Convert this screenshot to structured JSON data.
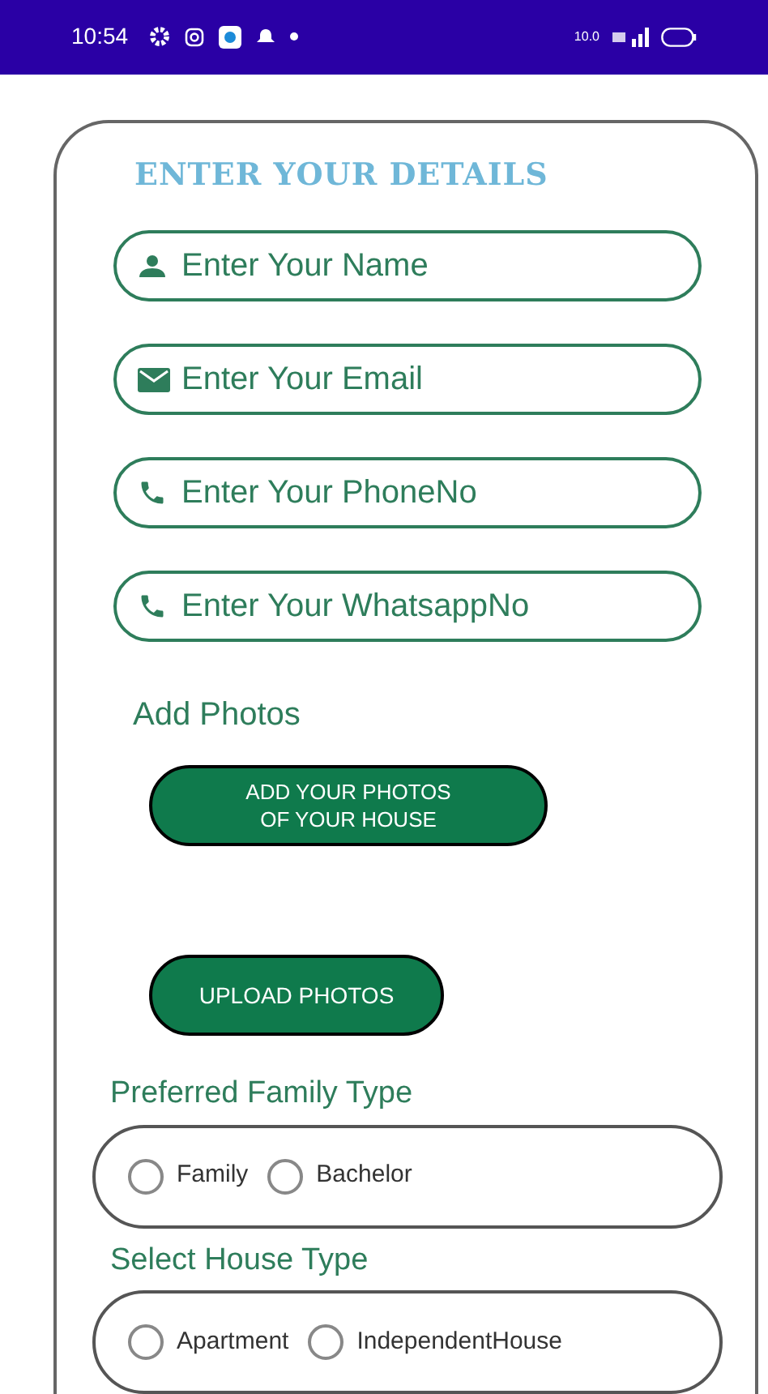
{
  "status_bar": {
    "time": "10:54",
    "speed": "10.0"
  },
  "title": "ENTER YOUR DETAILS",
  "fields": [
    {
      "kind": "person",
      "placeholder": "Enter Your Name"
    },
    {
      "kind": "mail",
      "placeholder": "Enter Your Email"
    },
    {
      "kind": "phone",
      "placeholder": "Enter Your PhoneNo"
    },
    {
      "kind": "phone",
      "placeholder": "Enter Your WhatsappNo"
    }
  ],
  "photos": {
    "heading": "Add Photos",
    "add_button": [
      "ADD YOUR PHOTOS",
      "OF YOUR HOUSE"
    ],
    "upload_button": "UPLOAD PHOTOS"
  },
  "groups": [
    {
      "heading": "Preferred Family Type",
      "options": [
        {
          "label": "Family",
          "selected": false
        },
        {
          "label": "Bachelor",
          "selected": false
        }
      ]
    },
    {
      "heading": "Select House Type",
      "options": [
        {
          "label": "Apartment",
          "selected": false
        },
        {
          "label": "IndependentHouse",
          "selected": false
        }
      ]
    }
  ]
}
